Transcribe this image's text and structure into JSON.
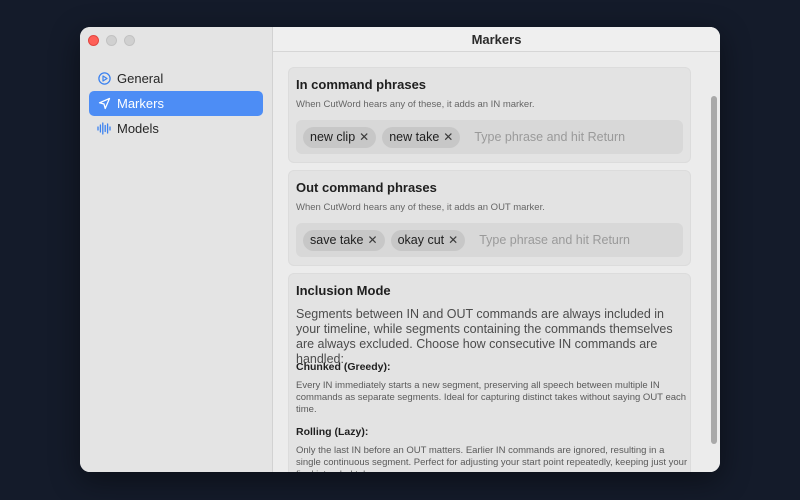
{
  "window": {
    "title": "Markers"
  },
  "sidebar": {
    "items": [
      {
        "label": "General",
        "icon": "play-circle-icon",
        "active": false
      },
      {
        "label": "Markers",
        "icon": "location-arrow-icon",
        "active": true
      },
      {
        "label": "Models",
        "icon": "waveform-icon",
        "active": false
      }
    ]
  },
  "in_section": {
    "title": "In command phrases",
    "subtitle": "When CutWord hears any of these, it adds an IN marker.",
    "chips": [
      "new clip",
      "new take"
    ],
    "placeholder": "Type phrase and hit Return"
  },
  "out_section": {
    "title": "Out command phrases",
    "subtitle": "When CutWord hears any of these, it adds an OUT marker.",
    "chips": [
      "save take",
      "okay cut"
    ],
    "placeholder": "Type phrase and hit Return"
  },
  "inclusion": {
    "title": "Inclusion Mode",
    "body": "Segments between IN and OUT commands are always included in your timeline, while segments containing the commands themselves are always excluded. Choose how consecutive IN commands are handled:",
    "chunked_title": "Chunked (Greedy):",
    "chunked_body": "Every IN immediately starts a new segment, preserving all speech between multiple IN commands as separate segments. Ideal for capturing distinct takes without saying OUT each time.",
    "rolling_title": "Rolling (Lazy):",
    "rolling_body": "Only the last IN before an OUT matters. Earlier IN commands are ignored, resulting in a single continuous segment. Perfect for adjusting your start point repeatedly, keeping just your final intended take."
  },
  "colors": {
    "accent": "#4d8df5",
    "close": "#fe5f57"
  }
}
